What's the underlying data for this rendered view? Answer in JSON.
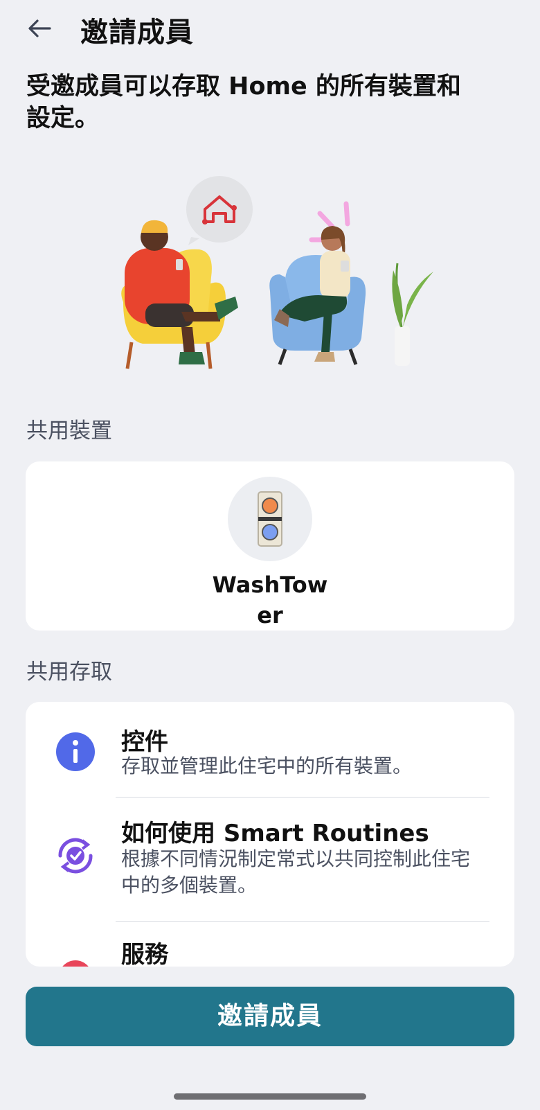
{
  "header": {
    "title": "邀請成員",
    "back_icon": "arrow-left-icon"
  },
  "intro": {
    "text": "受邀成員可以存取 Home 的所有裝置和設定。"
  },
  "shared_devices": {
    "label": "共用裝置",
    "items": [
      {
        "name": "WashTower",
        "icon": "washtower-icon"
      }
    ]
  },
  "shared_access": {
    "label": "共用存取",
    "items": [
      {
        "title": "控件",
        "description": "存取並管理此住宅中的所有裝置。",
        "icon": "info-icon",
        "color": "#5169e8"
      },
      {
        "title": "如何使用 Smart Routines",
        "description": "根據不同情況制定常式以共同控制此住宅中的多個裝置。",
        "icon": "routine-check-icon",
        "color": "#7a4fe0"
      },
      {
        "title": "服務",
        "description": "",
        "icon": "service-icon",
        "color": "#e8455a"
      }
    ]
  },
  "footer": {
    "invite_button": "邀請成員"
  },
  "colors": {
    "background": "#eff0f4",
    "accent": "#22768c",
    "home_icon": "#d8343a"
  }
}
